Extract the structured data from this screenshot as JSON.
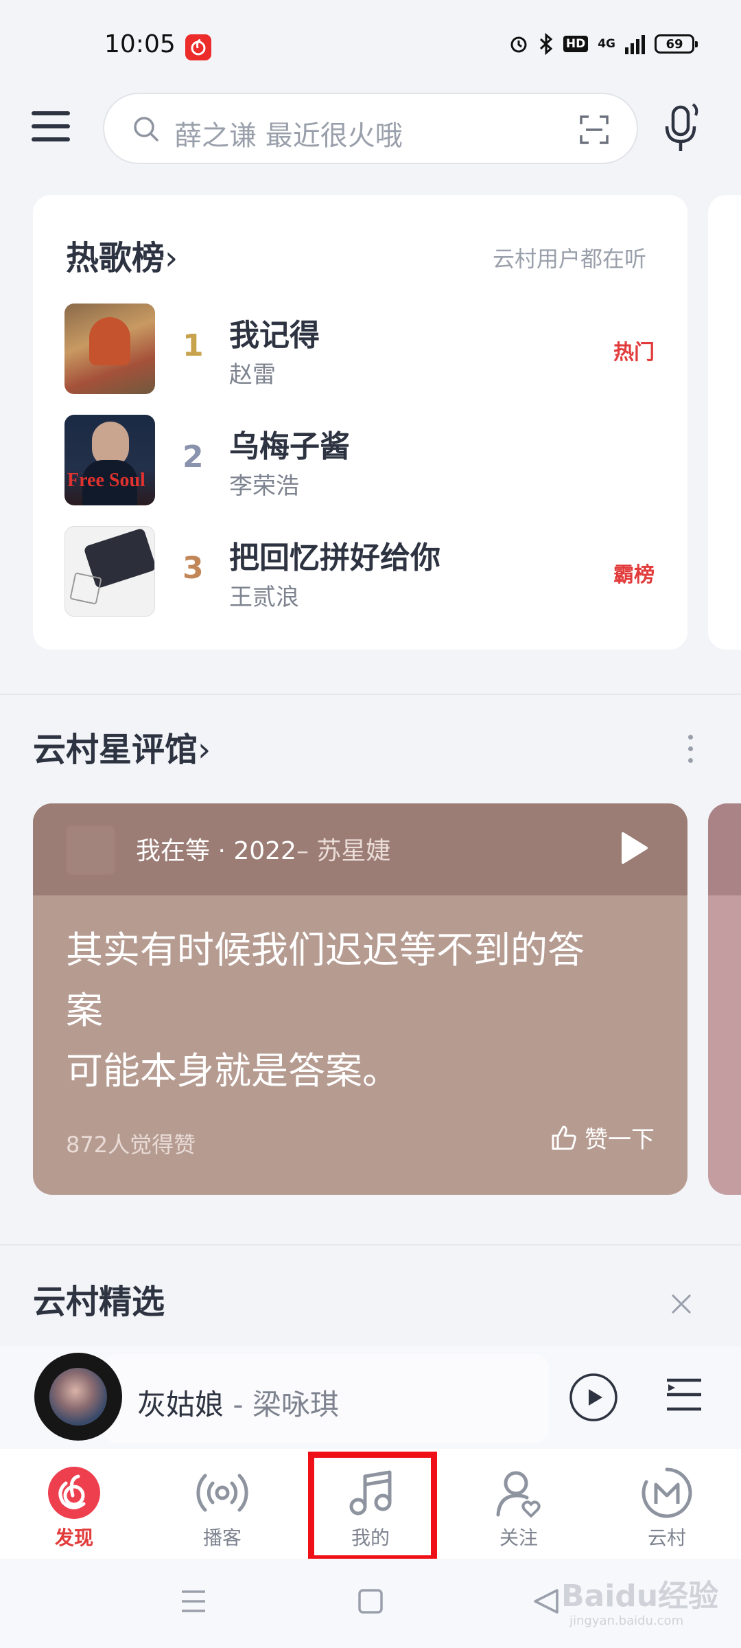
{
  "status_bar": {
    "time": "10:05",
    "network": "4G",
    "battery": "69",
    "icons": [
      "netease-app-icon",
      "alarm-icon",
      "bluetooth-icon",
      "hd-icon",
      "signal-icon",
      "battery-icon"
    ]
  },
  "header": {
    "search_placeholder": "薛之谦 最近很火哦",
    "icons": [
      "menu-icon",
      "search-icon",
      "scan-icon",
      "mic-icon"
    ]
  },
  "hot_songs": {
    "title": "热歌榜",
    "subtitle": "云村用户都在听",
    "songs": [
      {
        "rank": "1",
        "name": "我记得",
        "artist": "赵雷",
        "tag": "热门",
        "rank_color": "#c9a24d"
      },
      {
        "rank": "2",
        "name": "乌梅子酱",
        "artist": "李荣浩",
        "tag": "",
        "rank_color": "#8a93ad"
      },
      {
        "rank": "3",
        "name": "把回忆拼好给你",
        "artist": "王贰浪",
        "tag": "霸榜",
        "rank_color": "#c28758"
      }
    ],
    "cover_texts": [
      "Free",
      "Soul"
    ]
  },
  "star_reviews": {
    "title": "云村星评馆",
    "song": "我在等 · 2022",
    "artist": "– 苏星婕",
    "quote_line1": "其实有时候我们迟迟等不到的答",
    "quote_line2": "案",
    "quote_line3": "可能本身就是答案。",
    "likes": "872人觉得赞",
    "like_label": "赞一下"
  },
  "selection": {
    "title": "云村精选"
  },
  "mini_player": {
    "title": "灰姑娘",
    "artist": " - 梁咏琪"
  },
  "bottom_nav": {
    "items": [
      {
        "label": "发现",
        "icon": "discover-icon",
        "active": true
      },
      {
        "label": "播客",
        "icon": "podcast-icon",
        "active": false
      },
      {
        "label": "我的",
        "icon": "music-note-icon",
        "active": false
      },
      {
        "label": "关注",
        "icon": "follow-icon",
        "active": false
      },
      {
        "label": "云村",
        "icon": "cloud-village-icon",
        "active": false
      }
    ]
  },
  "watermark": {
    "text": "Baidu经验",
    "sub": "jingyan.baidu.com"
  },
  "colors": {
    "accent": "#e23b3b",
    "review_card": "#b69b91",
    "highlight_box": "#ee0f17"
  }
}
